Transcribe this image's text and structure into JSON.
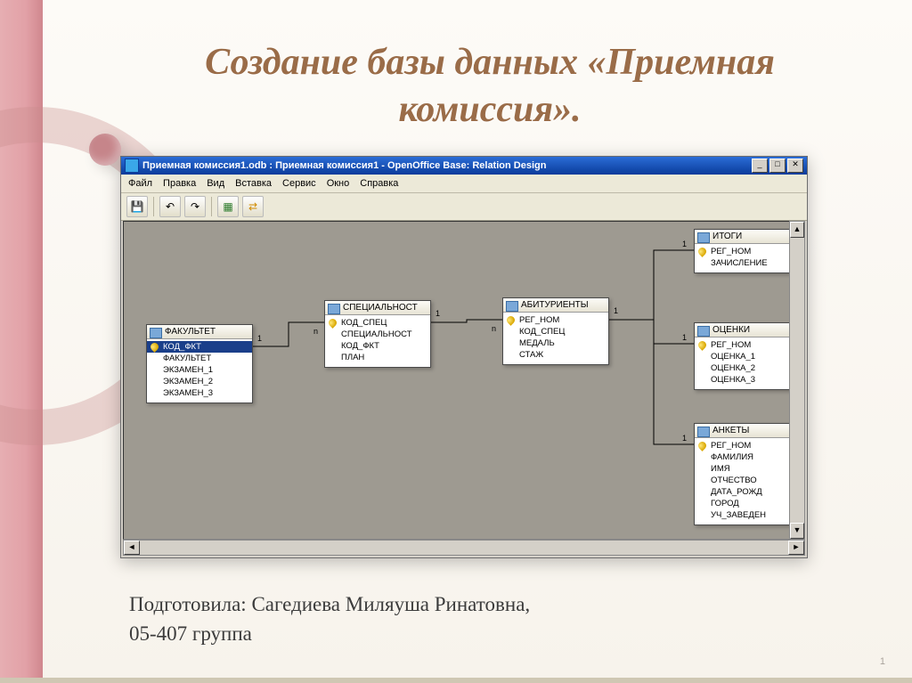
{
  "slide": {
    "title": "Создание базы данных «Приемная комиссия».",
    "author_line1": "Подготовила: Сагедиева Миляуша Ринатовна,",
    "author_line2": "05-407 группа",
    "page_number": "1"
  },
  "window": {
    "title": "Приемная комиссия1.odb : Приемная комиссия1 - OpenOffice Base: Relation Design",
    "menus": [
      "Файл",
      "Правка",
      "Вид",
      "Вставка",
      "Сервис",
      "Окно",
      "Справка"
    ],
    "win_controls": {
      "min": "_",
      "max": "□",
      "close": "✕"
    },
    "toolbar_icons": {
      "save": "save-icon",
      "undo": "undo-icon",
      "redo": "redo-icon",
      "add_table": "add-table-icon",
      "new_relation": "new-relation-icon"
    }
  },
  "tables": {
    "fakultet": {
      "title": "ФАКУЛЬТЕТ",
      "fields": [
        {
          "name": "КОД_ФКТ",
          "key": true,
          "selected": true
        },
        {
          "name": "ФАКУЛЬТЕТ"
        },
        {
          "name": "ЭКЗАМЕН_1"
        },
        {
          "name": "ЭКЗАМЕН_2"
        },
        {
          "name": "ЭКЗАМЕН_3"
        }
      ]
    },
    "spec": {
      "title": "СПЕЦИАЛЬНОСТ",
      "fields": [
        {
          "name": "КОД_СПЕЦ",
          "key": true
        },
        {
          "name": "СПЕЦИАЛЬНОСТ"
        },
        {
          "name": "КОД_ФКТ"
        },
        {
          "name": "ПЛАН"
        }
      ]
    },
    "abitur": {
      "title": "АБИТУРИЕНТЫ",
      "fields": [
        {
          "name": "РЕГ_НОМ",
          "key": true
        },
        {
          "name": "КОД_СПЕЦ"
        },
        {
          "name": "МЕДАЛЬ"
        },
        {
          "name": "СТАЖ"
        }
      ]
    },
    "itogi": {
      "title": "ИТОГИ",
      "fields": [
        {
          "name": "РЕГ_НОМ",
          "key": true
        },
        {
          "name": "ЗАЧИСЛЕНИЕ"
        }
      ]
    },
    "ocenki": {
      "title": "ОЦЕНКИ",
      "fields": [
        {
          "name": "РЕГ_НОМ",
          "key": true
        },
        {
          "name": "ОЦЕНКА_1"
        },
        {
          "name": "ОЦЕНКА_2"
        },
        {
          "name": "ОЦЕНКА_3"
        }
      ]
    },
    "ankety": {
      "title": "АНКЕТЫ",
      "fields": [
        {
          "name": "РЕГ_НОМ",
          "key": true
        },
        {
          "name": "ФАМИЛИЯ"
        },
        {
          "name": "ИМЯ"
        },
        {
          "name": "ОТЧЕСТВО"
        },
        {
          "name": "ДАТА_РОЖД"
        },
        {
          "name": "ГОРОД"
        },
        {
          "name": "УЧ_ЗАВЕДЕН"
        }
      ]
    }
  },
  "relation_labels": {
    "one": "1",
    "many": "n"
  }
}
